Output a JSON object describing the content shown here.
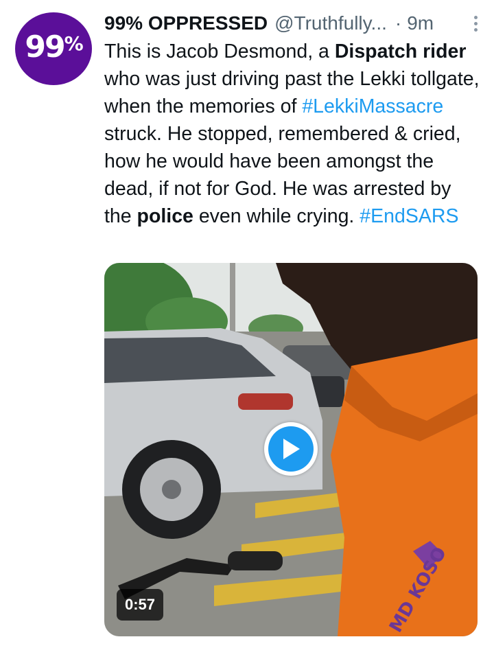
{
  "tweet": {
    "avatar": {
      "text": "99",
      "pct": "%",
      "color": "#5b0f99"
    },
    "display_name": "99% OPPRESSED",
    "handle": "@Truthfully...",
    "separator": "·",
    "time": "9m",
    "more_icon": "more-vertical-icon",
    "text_segments": [
      {
        "t": "This is Jacob Desmond, a "
      },
      {
        "t": "Dispatch rider",
        "style": "bold"
      },
      {
        "t": " who was just driving past the Lekki tollgate, when the memories of "
      },
      {
        "t": "#LekkiMassacre",
        "style": "hashtag"
      },
      {
        "t": " struck. He stopped, remembered & cried, how he would have been amongst the dead, if not for God. He was arrested by the "
      },
      {
        "t": "police",
        "style": "bold"
      },
      {
        "t": " even while crying. "
      },
      {
        "t": "#EndSARS",
        "style": "hashtag"
      }
    ],
    "media": {
      "type": "video",
      "duration": "0:57",
      "play_icon": "play-icon",
      "shirt_logo_text": "MD KOSO",
      "accent": "#1d9bf0"
    }
  }
}
